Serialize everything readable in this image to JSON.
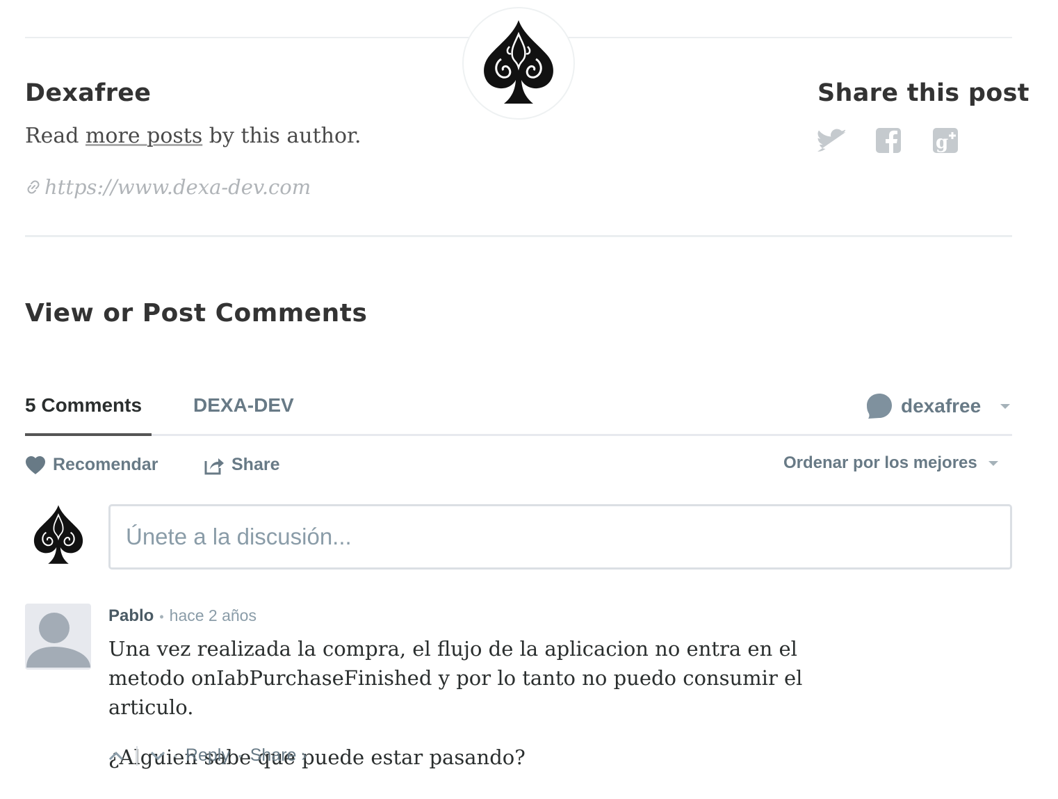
{
  "author": {
    "name": "Dexafree",
    "bio_prefix": "Read ",
    "bio_link": "more posts",
    "bio_suffix": " by this author.",
    "website": "https://www.dexa-dev.com"
  },
  "share": {
    "title": "Share this post",
    "icons": [
      "twitter-icon",
      "facebook-icon",
      "google-plus-icon"
    ]
  },
  "comments_section": {
    "title": "View or Post Comments"
  },
  "disqus": {
    "tab_comments": "5 Comments",
    "tab_community": "DEXA-DEV",
    "username": "dexafree",
    "recommend_label": "Recomendar",
    "share_label": "Share",
    "sort_label": "Ordenar por los mejores",
    "input_placeholder": "Únete a la discusión...",
    "comment": {
      "author": "Pablo",
      "time": "hace 2 años",
      "paragraphs": [
        "Una vez realizada la compra, el flujo de la aplicacion no entra en el metodo onIabPurchaseFinished y por lo tanto no puedo consumir el articulo.",
        "¿Alguien sabe que puede estar pasando?"
      ],
      "reply_label": "Reply",
      "share_label": "Share ›"
    }
  },
  "colors": {
    "accent": "#687a86",
    "muted": "#a5b2b9",
    "border": "#dbdfe4"
  }
}
